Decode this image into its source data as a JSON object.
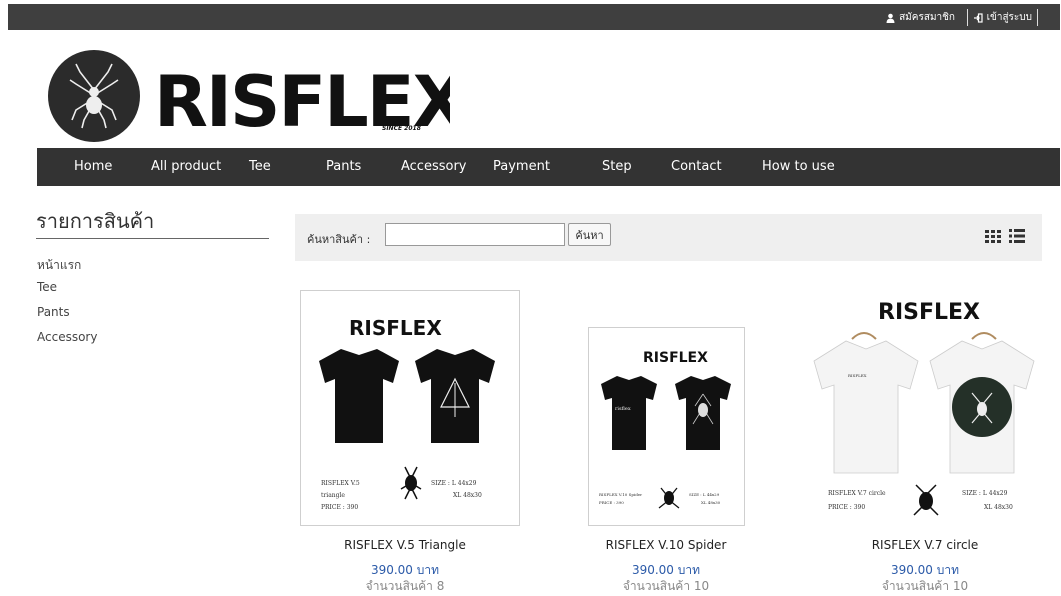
{
  "topbar": {
    "register_label": "สมัครสมาชิก",
    "login_label": "เข้าสู่ระบบ"
  },
  "brand": {
    "wordmark": "RISFLEX",
    "since": "SINCE 2018"
  },
  "nav": {
    "items": [
      "Home",
      "All product",
      "Tee",
      "Pants",
      "Accessory",
      "Payment",
      "Step",
      "Contact",
      "How to use"
    ]
  },
  "sidebar": {
    "title": "รายการสินค้า",
    "links": [
      "หน้าแรก",
      "Tee",
      "Pants",
      "Accessory"
    ]
  },
  "search": {
    "label": "ค้นหาสินค้า :",
    "value": "",
    "placeholder": "",
    "button_label": "ค้นหา"
  },
  "products": [
    {
      "name": "RISFLEX V.5 Triangle",
      "price": "390.00 บาท",
      "stock": "จำนวนสินค้า 8",
      "image_text": {
        "model": "RISFLEX V.5",
        "model2": "triangle",
        "price": "PRICE : 390",
        "size1": "SIZE : L  44x29",
        "size2": "XL  48x30"
      }
    },
    {
      "name": "RISFLEX V.10 Spider",
      "price": "390.00 บาท",
      "stock": "จำนวนสินค้า 10",
      "image_text": {
        "model": "RISFLEX V.10 Spider",
        "model2": "",
        "price": "PRICE : 390",
        "size1": "SIZE : L  44x29",
        "size2": "XL  48x30"
      }
    },
    {
      "name": "RISFLEX V.7 circle",
      "price": "390.00 บาท",
      "stock": "จำนวนสินค้า 10",
      "image_text": {
        "model": "RISFLEX V.7 circle",
        "model2": "",
        "price": "PRICE : 390",
        "size1": "SIZE : L  44x29",
        "size2": "XL  48x30"
      }
    }
  ],
  "colors": {
    "topbar": "#3f3f3f",
    "nav": "#333333",
    "price": "#2b5aa8",
    "search_bg": "#efefef"
  }
}
